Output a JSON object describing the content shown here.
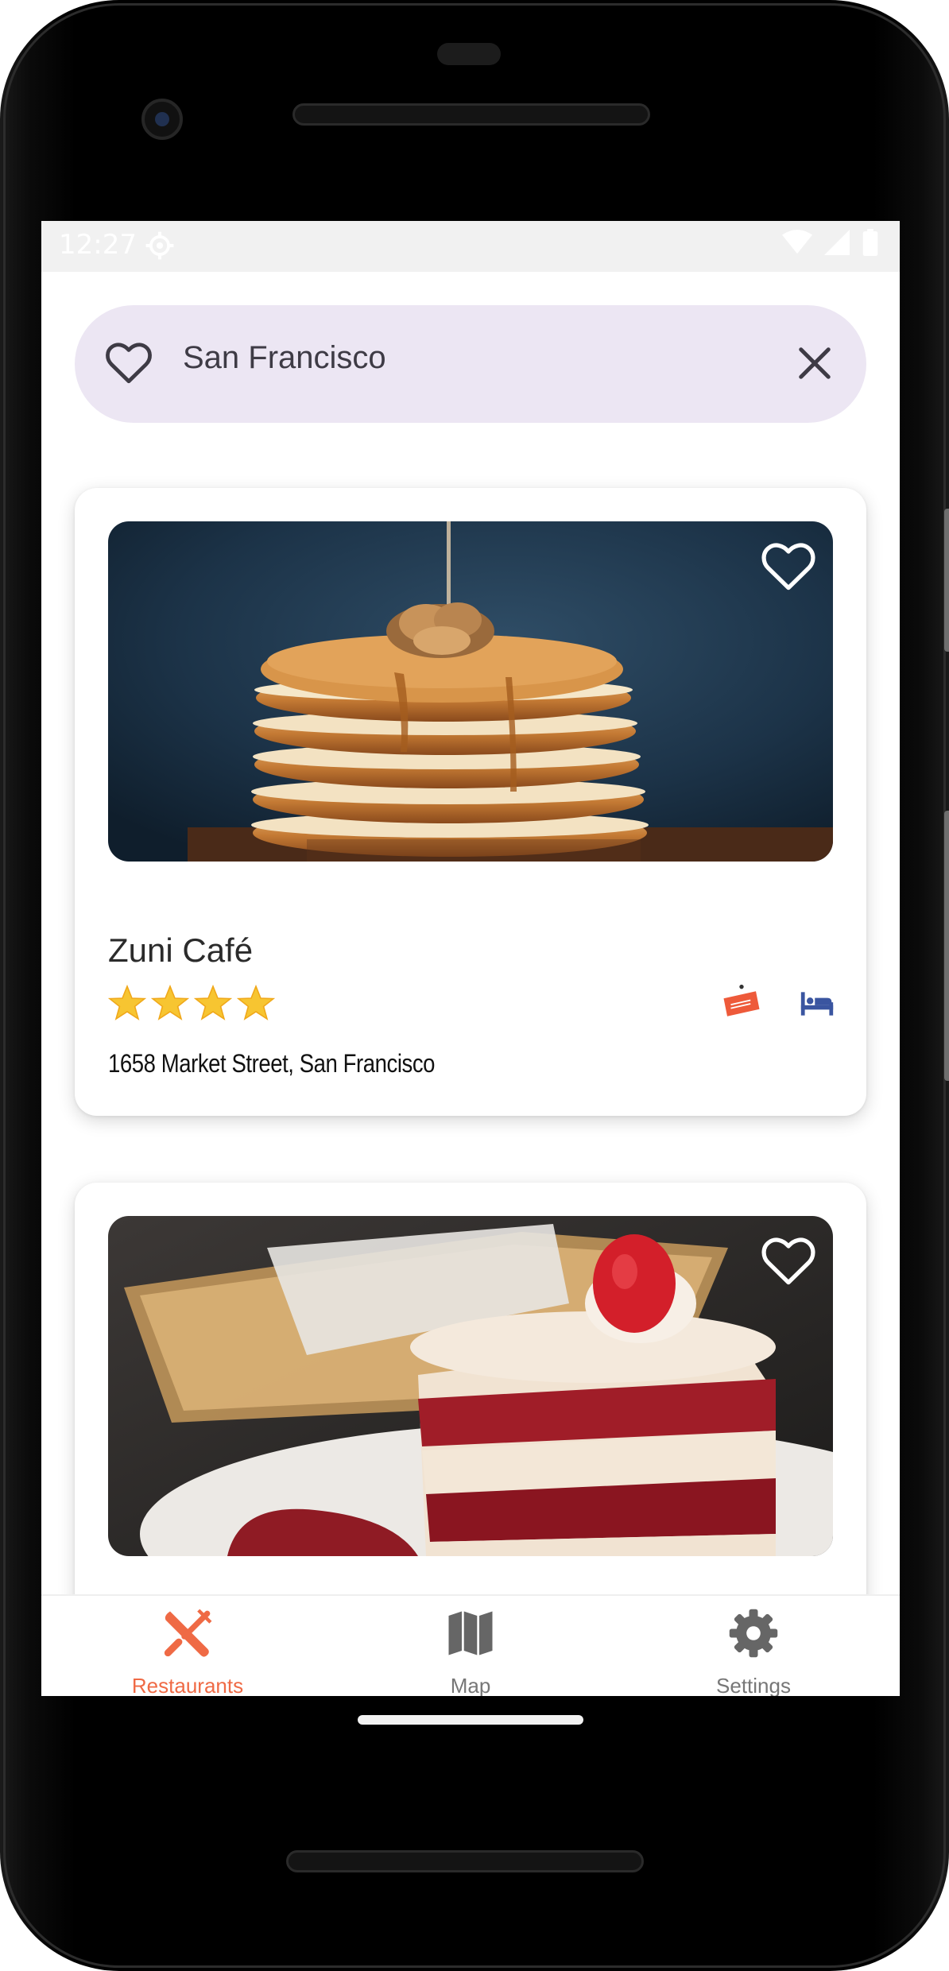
{
  "status_bar": {
    "time": "12:27",
    "icons": [
      "settings-icon",
      "wifi-icon",
      "signal-icon",
      "battery-icon"
    ]
  },
  "search": {
    "value": "San Francisco",
    "leading_icon": "heart-outline-icon",
    "trailing_icon": "close-icon"
  },
  "restaurants": [
    {
      "name": "Zuni Café",
      "rating_stars": 4,
      "address": "1658 Market Street, San Francisco",
      "image": "pancakes-photo",
      "badges": [
        "open-sign-icon",
        "bed-icon"
      ]
    },
    {
      "name": "",
      "image": "red-velvet-cake-photo"
    }
  ],
  "bottom_nav": {
    "items": [
      {
        "label": "Restaurants",
        "icon": "fork-knife-icon",
        "active": true
      },
      {
        "label": "Map",
        "icon": "map-icon",
        "active": false
      },
      {
        "label": "Settings",
        "icon": "gear-icon",
        "active": false
      }
    ]
  },
  "colors": {
    "accent": "#ef6a45",
    "search_bg": "#ece6f3",
    "hotel_icon": "#3a55a0",
    "star": "#f7c531"
  }
}
